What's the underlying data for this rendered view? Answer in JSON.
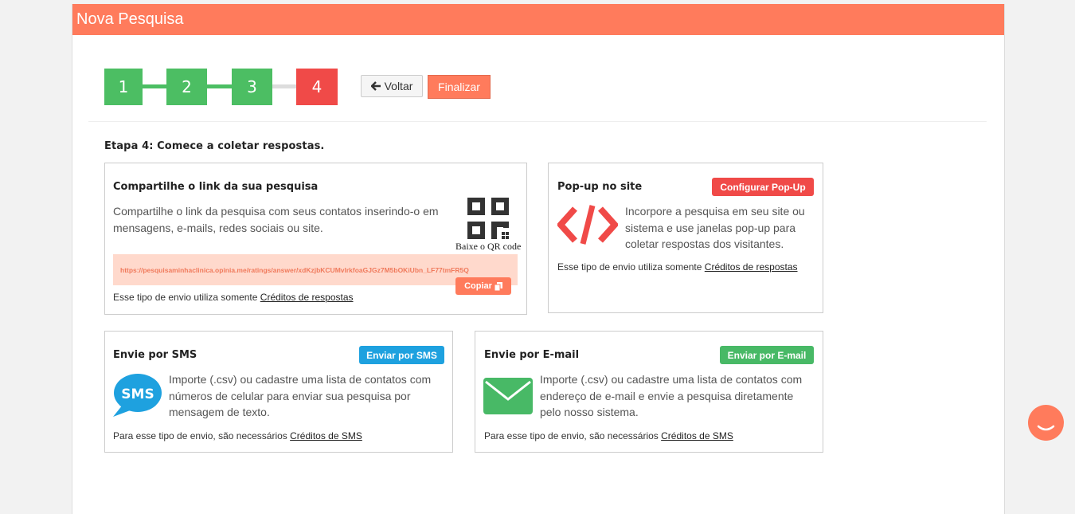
{
  "header": {
    "title": "Nova Pesquisa"
  },
  "steps": [
    {
      "label": "1",
      "status": "done"
    },
    {
      "label": "2",
      "status": "done"
    },
    {
      "label": "3",
      "status": "done"
    },
    {
      "label": "4",
      "status": "current"
    }
  ],
  "actions": {
    "back_label": "Voltar",
    "finish_label": "Finalizar"
  },
  "section_title": "Etapa 4: Comece a coletar respostas.",
  "share_link": {
    "title": "Compartilhe o link da sua pesquisa",
    "description": "Compartilhe o link da pesquisa com seus contatos inserindo-o em mensagens, e-mails, redes sociais ou site.",
    "qr_caption": "Baixe o QR code",
    "url": "https://pesquisaminhaclinica.opinia.me/ratings/answer/xdKzjbKCUMvlrkfoaGJGz7M5bOKiUbn_LF77tmFR5Q",
    "copy_label": "Copiar",
    "footer_prefix": "Esse tipo de envio utiliza somente",
    "footer_link": "Créditos de respostas"
  },
  "popup": {
    "title": "Pop-up no site",
    "button_label": "Configurar Pop-Up",
    "description": "Incorpore a pesquisa em seu site ou sistema e use janelas pop-up para coletar respostas dos visitantes.",
    "footer_prefix": "Esse tipo de envio utiliza somente",
    "footer_link": "Créditos de respostas"
  },
  "sms": {
    "title": "Envie por SMS",
    "button_label": "Enviar por SMS",
    "icon_text": "SMS",
    "description": "Importe (.csv) ou cadastre uma lista de contatos com números de celular para enviar sua pesquisa por mensagem de texto.",
    "footer_prefix": "Para esse tipo de envio, são necessários",
    "footer_link": "Créditos de SMS"
  },
  "email": {
    "title": "Envie por E-mail",
    "button_label": "Enviar por E-mail",
    "description": "Importe (.csv) ou cadastre uma lista de contatos com endereço de e-mail e envie a pesquisa diretamente pelo nosso sistema.",
    "footer_prefix": "Para esse tipo de envio, são necessários",
    "footer_link": "Créditos de SMS"
  },
  "colors": {
    "accent": "#ff7b5c",
    "step_done": "#4cbe63",
    "step_current": "#f04a48",
    "sms_blue": "#1ea1df",
    "email_green": "#48b966",
    "popup_red": "#f04a48"
  },
  "icons": {
    "back": "arrow-left-icon",
    "qr": "qr-code-icon",
    "copy": "copy-icon",
    "code": "code-icon",
    "sms": "sms-bubble-icon",
    "email": "envelope-icon",
    "chat": "chat-icon"
  }
}
